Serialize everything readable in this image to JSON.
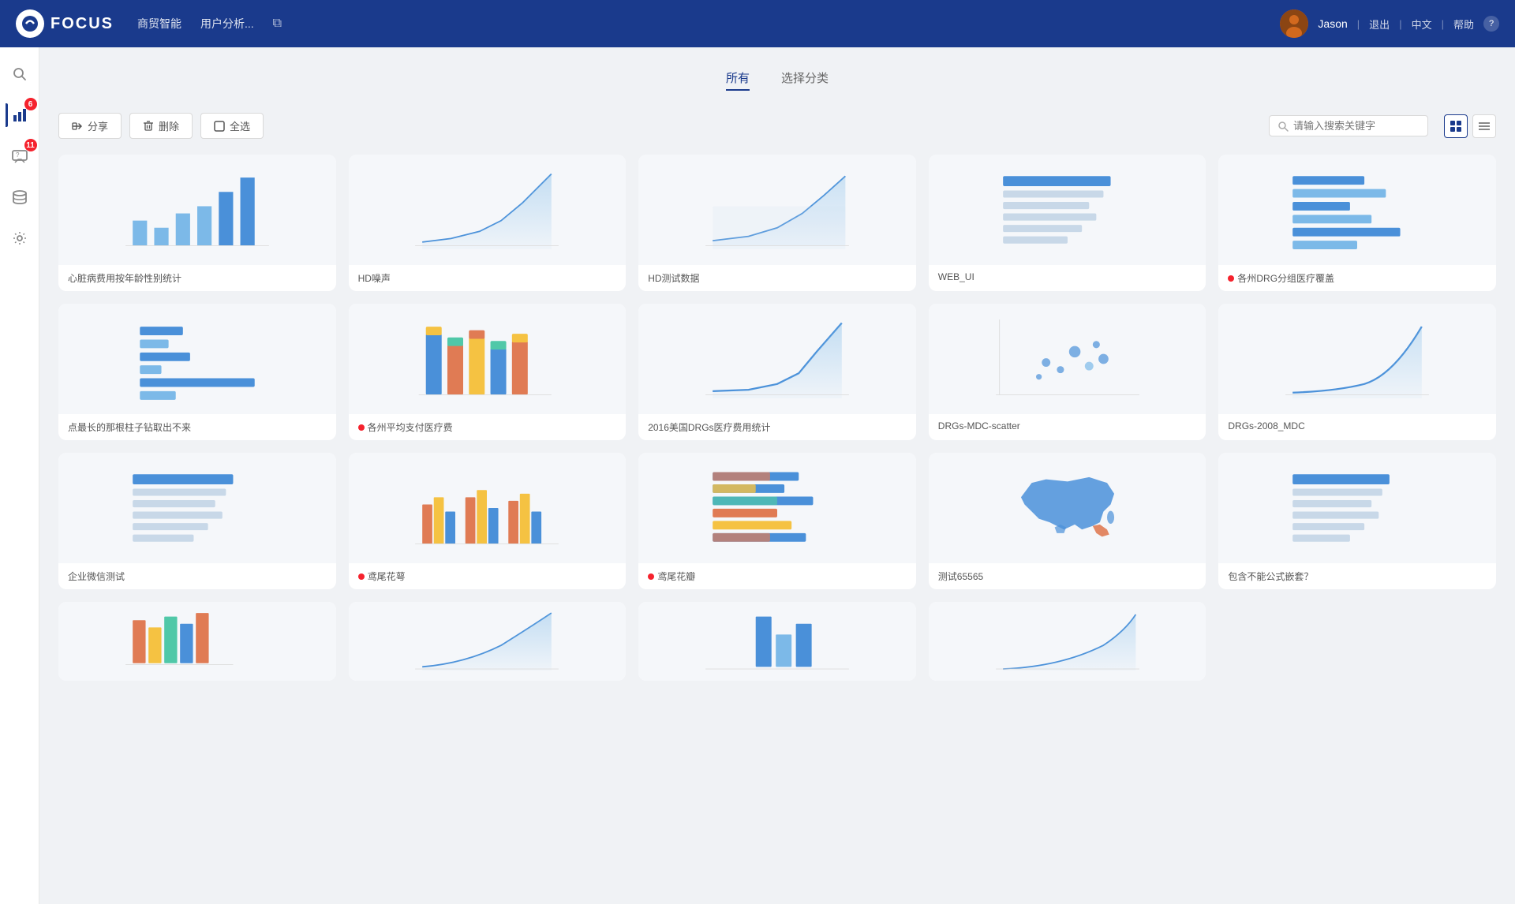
{
  "header": {
    "logo_text": "FOCUS",
    "nav": [
      "商贸智能",
      "用户分析...",
      ""
    ],
    "user_name": "Jason",
    "links": [
      "退出",
      "中文",
      "帮助"
    ],
    "dividers": [
      "|",
      "|"
    ]
  },
  "sidebar": {
    "items": [
      {
        "name": "search",
        "icon": "🔍",
        "badge": null
      },
      {
        "name": "reports",
        "icon": "📊",
        "badge": "6"
      },
      {
        "name": "messages",
        "icon": "💬",
        "badge": "11"
      },
      {
        "name": "database",
        "icon": "🗄️",
        "badge": null
      },
      {
        "name": "settings",
        "icon": "⚙️",
        "badge": null
      }
    ]
  },
  "tabs": [
    {
      "label": "所有",
      "active": true
    },
    {
      "label": "选择分类",
      "active": false
    }
  ],
  "toolbar": {
    "share_label": "分享",
    "delete_label": "删除",
    "selectall_label": "全选",
    "search_placeholder": "请输入搜索关键字"
  },
  "cards": [
    {
      "id": 1,
      "title": "心脏病费用按年龄性别统计",
      "dot": false,
      "type": "bar_chart"
    },
    {
      "id": 2,
      "title": "HD噪声",
      "dot": false,
      "type": "line_chart"
    },
    {
      "id": 3,
      "title": "HD测试数据",
      "dot": false,
      "type": "line_chart2"
    },
    {
      "id": 4,
      "title": "WEB_UI",
      "dot": false,
      "type": "table_preview"
    },
    {
      "id": 5,
      "title": "各州DRG分组医疗覆盖",
      "dot": true,
      "type": "horiz_bar"
    },
    {
      "id": 6,
      "title": "点最长的那根柱子钻取出不来",
      "dot": false,
      "type": "horiz_bar2"
    },
    {
      "id": 7,
      "title": "各州平均支付医疗费",
      "dot": true,
      "type": "stacked_bar"
    },
    {
      "id": 8,
      "title": "2016美国DRGs医疗费用统计",
      "dot": false,
      "type": "line_chart3"
    },
    {
      "id": 9,
      "title": "DRGs-MDC-scatter",
      "dot": false,
      "type": "scatter"
    },
    {
      "id": 10,
      "title": "DRGs-2008_MDC",
      "dot": false,
      "type": "line_curve"
    },
    {
      "id": 11,
      "title": "企业微信测试",
      "dot": false,
      "type": "table_preview2"
    },
    {
      "id": 12,
      "title": "鸢尾花萼",
      "dot": true,
      "type": "multi_bar"
    },
    {
      "id": 13,
      "title": "鸢尾花瓣",
      "dot": true,
      "type": "multi_horiz"
    },
    {
      "id": 14,
      "title": "测试65565",
      "dot": false,
      "type": "map"
    },
    {
      "id": 15,
      "title": "包含不能公式嵌套？",
      "dot": false,
      "type": "table_preview3"
    }
  ],
  "bottom_cards_visible": true
}
